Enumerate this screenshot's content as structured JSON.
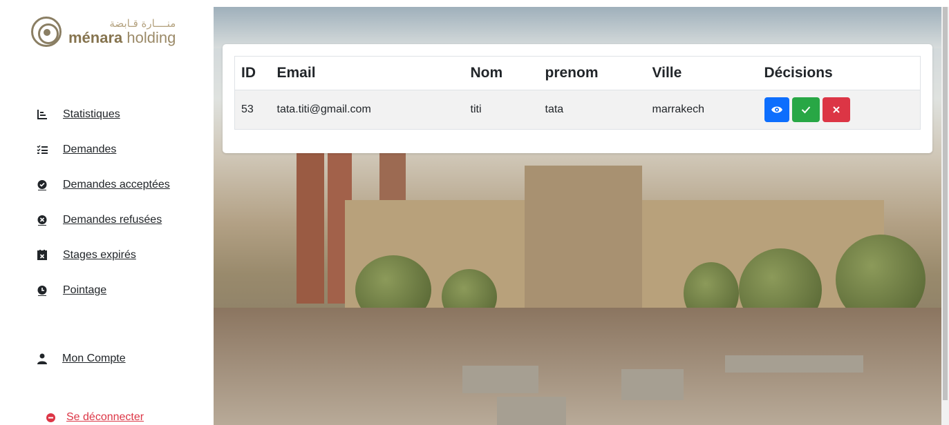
{
  "brand": {
    "arabic_name": "منــــارة قـابضة",
    "latin_bold": "ménara",
    "latin_light": " holding"
  },
  "sidebar": {
    "items": [
      {
        "label": "Statistiques",
        "icon": "stats-list-icon"
      },
      {
        "label": "Demandes",
        "icon": "checklist-icon"
      },
      {
        "label": "Demandes acceptées",
        "icon": "check-circle-icon"
      },
      {
        "label": "Demandes refusées",
        "icon": "x-circle-icon"
      },
      {
        "label": "Stages expirés",
        "icon": "calendar-x-icon"
      },
      {
        "label": "Pointage",
        "icon": "clock-icon"
      }
    ],
    "account": {
      "label": "Mon Compte",
      "icon": "user-icon"
    },
    "logout": {
      "label": "Se déconnecter",
      "icon": "logout-icon"
    }
  },
  "table": {
    "headers": [
      "ID",
      "Email",
      "Nom",
      "prenom",
      "Ville",
      "Décisions"
    ],
    "rows": [
      {
        "id": "53",
        "email": "tata.titi@gmail.com",
        "nom": "titi",
        "prenom": "tata",
        "ville": "marrakech"
      }
    ],
    "actions": {
      "view_icon": "eye-icon",
      "accept_icon": "check-icon",
      "refuse_icon": "x-icon"
    }
  },
  "colors": {
    "view": "#0d6efd",
    "accept": "#28a745",
    "refuse": "#dc3545",
    "logout": "#dc3545",
    "brand": "#8a7e63"
  }
}
